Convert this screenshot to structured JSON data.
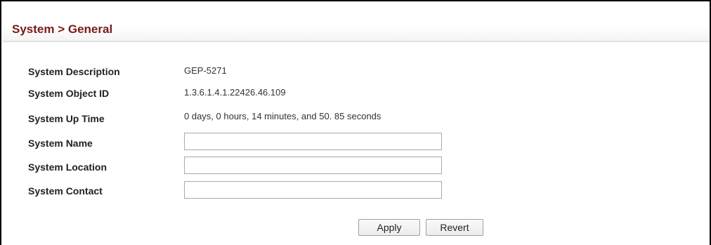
{
  "page": {
    "title": "System > General"
  },
  "fields": {
    "description": {
      "label": "System Description",
      "value": "GEP-5271"
    },
    "object_id": {
      "label": "System Object ID",
      "value": "1.3.6.1.4.1.22426.46.109"
    },
    "up_time": {
      "label": "System Up Time",
      "value": "0 days, 0 hours, 14 minutes, and 50. 85 seconds"
    },
    "name": {
      "label": "System Name",
      "value": ""
    },
    "location": {
      "label": "System Location",
      "value": ""
    },
    "contact": {
      "label": "System Contact",
      "value": ""
    }
  },
  "actions": {
    "apply_label": "Apply",
    "revert_label": "Revert"
  },
  "colors": {
    "title": "#7a1a1a",
    "header_rule": "#e2e2e2"
  }
}
